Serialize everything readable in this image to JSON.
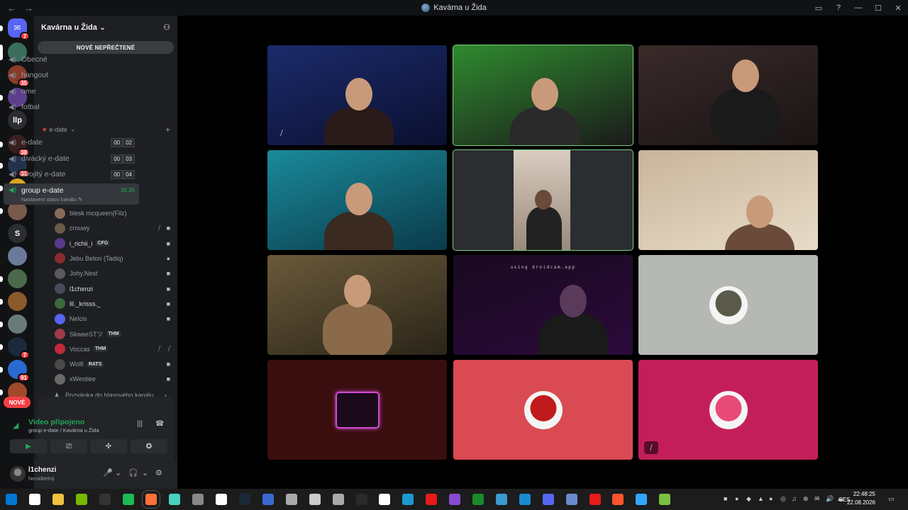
{
  "window": {
    "title": "Kavárna u Žida",
    "nav_back": "←",
    "nav_forward": "→",
    "controls": [
      "▭",
      "?",
      "—",
      "☐",
      "✕"
    ]
  },
  "guilds": [
    {
      "badge": "7",
      "color": "#5865f2",
      "glyph": "✉"
    },
    {
      "badge": "",
      "color": "#3b6e5e",
      "glyph": ""
    },
    {
      "badge": "35",
      "color": "#8a3b2a",
      "glyph": ""
    },
    {
      "badge": "",
      "color": "#5b3f8c",
      "glyph": ""
    },
    {
      "badge": "",
      "color": "#2b2d31",
      "glyph": "llp"
    },
    {
      "badge": "38",
      "color": "#3a1f1f",
      "glyph": ""
    },
    {
      "badge": "35",
      "color": "#22324a",
      "glyph": ""
    },
    {
      "badge": "8",
      "color": "#d9a520",
      "glyph": ""
    },
    {
      "badge": "",
      "color": "#7a5a4a",
      "glyph": ""
    },
    {
      "badge": "",
      "color": "#2b2d31",
      "glyph": "S"
    },
    {
      "badge": "",
      "color": "#6a7a9a",
      "glyph": ""
    },
    {
      "badge": "",
      "color": "#4a6a4a",
      "glyph": ""
    },
    {
      "badge": "",
      "color": "#8a5a2a",
      "glyph": ""
    },
    {
      "badge": "",
      "color": "#6a7a7a",
      "glyph": ""
    },
    {
      "badge": "7",
      "color": "#1a2a3a",
      "glyph": ""
    },
    {
      "badge": "91",
      "color": "#2a6ad0",
      "glyph": ""
    },
    {
      "badge": "",
      "color": "#a04a2a",
      "glyph": ""
    }
  ],
  "new_pill": "NOVÉ",
  "server": {
    "name": "Kavárna u Žida",
    "new_unread": "NOVÉ NEPŘEČTENÉ",
    "channels_top": [
      "Obecné",
      "hangout",
      "ome",
      "fotbal"
    ],
    "category": {
      "label": "e-date"
    },
    "channels": [
      {
        "name": "e-date",
        "count_a": "00",
        "count_b": "02"
      },
      {
        "name": "divácký e-date",
        "count_a": "00",
        "count_b": "03"
      },
      {
        "name": "dvojitý e-date",
        "count_a": "00",
        "count_b": "04"
      }
    ],
    "active_channel": {
      "name": "group e-date",
      "time": "38:35",
      "status": "Nastavení stavu kanálu"
    },
    "members": [
      {
        "name": "blesk mcqueen(Filz)",
        "tag": "",
        "icons": [
          "",
          ""
        ],
        "color": "#8a6a5a"
      },
      {
        "name": "crouwy",
        "tag": "",
        "icons": [
          "⧸",
          "■"
        ],
        "color": "#6a5a4a"
      },
      {
        "name": "i_richii_i",
        "tag": "CFG",
        "icons": [
          "",
          "■"
        ],
        "color": "#5a3a8a"
      },
      {
        "name": "Jebu Beton (Tadiq)",
        "tag": "",
        "icons": [
          "",
          "●"
        ],
        "color": "#8a2a2a"
      },
      {
        "name": "Johy.Nest",
        "tag": "",
        "icons": [
          "",
          "■"
        ],
        "color": "#5a5a5a"
      },
      {
        "name": "l1chenzi",
        "tag": "",
        "icons": [
          "",
          "■"
        ],
        "color": "#4a4a5a"
      },
      {
        "name": "lil._krisss._",
        "tag": "",
        "icons": [
          "",
          "■"
        ],
        "color": "#3a6a3a"
      },
      {
        "name": "Nelcis",
        "tag": "",
        "icons": [
          "",
          "■"
        ],
        "color": "#5865f2"
      },
      {
        "name": "SkweeSTツ",
        "tag": "THM",
        "icons": [
          "",
          ""
        ],
        "color": "#a03a4a"
      },
      {
        "name": "Voccas",
        "tag": "THM",
        "icons": [
          "⧸",
          "⧸"
        ],
        "color": "#c02a3a"
      },
      {
        "name": "Wolfi",
        "tag": "RATS",
        "icons": [
          "",
          "■"
        ],
        "color": "#4a4a4a"
      },
      {
        "name": "xWestiee",
        "tag": "",
        "icons": [
          "",
          "■"
        ],
        "color": "#6a6a6a"
      }
    ],
    "invite": "Pozvánka do hlasového kanálu"
  },
  "voice": {
    "status": "Video připojeno",
    "sub": "group e-date / Kavárna u Žida",
    "buttons": [
      "▶",
      "⎚",
      "✣",
      "✪"
    ]
  },
  "user": {
    "name": "l1chenzi",
    "status": "Neviditelný",
    "controls": [
      "🎤",
      "⌄",
      "🎧",
      "⌄",
      "⚙"
    ]
  },
  "tiles": [
    {
      "bg": "#1c2a6a",
      "accent": "#0a1030",
      "person": "#2a1a1a",
      "speaking": false,
      "muted_icon": "⧸",
      "type": "cam"
    },
    {
      "bg": "#2f8a2f",
      "accent": "#1a1a1a",
      "person": "#2a2a2a",
      "speaking": true,
      "muted_icon": "",
      "type": "cam"
    },
    {
      "bg": "#3a2a2a",
      "accent": "#1a1414",
      "person": "#1a1a1a",
      "speaking": false,
      "muted_icon": "",
      "type": "cam"
    },
    {
      "bg": "#1a8a9a",
      "accent": "#0a3a4a",
      "person": "#3a2a20",
      "speaking": false,
      "muted_icon": "",
      "type": "cam"
    },
    {
      "bg": "#2b2d31",
      "accent": "#d8ccc0",
      "person": "#3a2a20",
      "speaking": true,
      "muted_icon": "",
      "type": "phone"
    },
    {
      "bg": "#c8b49a",
      "accent": "#e8dcc8",
      "person": "#6a4a3a",
      "speaking": false,
      "muted_icon": "",
      "type": "cam"
    },
    {
      "bg": "#6a5a3a",
      "accent": "#2a2418",
      "person": "#8a6a4a",
      "speaking": false,
      "muted_icon": "",
      "type": "cam"
    },
    {
      "bg": "#1a0a20",
      "accent": "#2a0a3a",
      "person": "#1a1a1a",
      "speaking": false,
      "muted_icon": "",
      "type": "cam",
      "overlay": "using droidcam.app"
    },
    {
      "bg": "#b5b8b3",
      "accent": "#5a5a4a",
      "person": "",
      "speaking": false,
      "muted_icon": "",
      "type": "avatar"
    },
    {
      "bg": "#3a0e0e",
      "accent": "#d04ad0",
      "person": "",
      "speaking": false,
      "muted_icon": "",
      "type": "avatar-square"
    },
    {
      "bg": "#d94a52",
      "accent": "#c01a1a",
      "person": "",
      "speaking": false,
      "muted_icon": "",
      "type": "avatar"
    },
    {
      "bg": "#c41e5a",
      "accent": "#e84a7a",
      "person": "",
      "speaking": false,
      "muted_icon": "⧸",
      "type": "avatar"
    }
  ],
  "taskbar": {
    "apps": [
      "#0078d4",
      "#ffffff",
      "#f0c040",
      "#76b900",
      "#333",
      "#1db954",
      "#ff7139",
      "#4ad0c0",
      "#888",
      "#fff",
      "#1b2838",
      "#3a6ad0",
      "#aaa",
      "#ccc",
      "#aaa",
      "#2a2a2a",
      "#fff",
      "#1a9ad0",
      "#e81a1a",
      "#8a4ad0",
      "#1a8a2a",
      "#3a9ad0",
      "#1a8ad0",
      "#5865f2",
      "#6a8ad0",
      "#e81a1a",
      "#fb542b",
      "#31a8ff",
      "#7ac040"
    ],
    "language": "CES",
    "time": "22:48:25",
    "date": "22.08.2026"
  }
}
